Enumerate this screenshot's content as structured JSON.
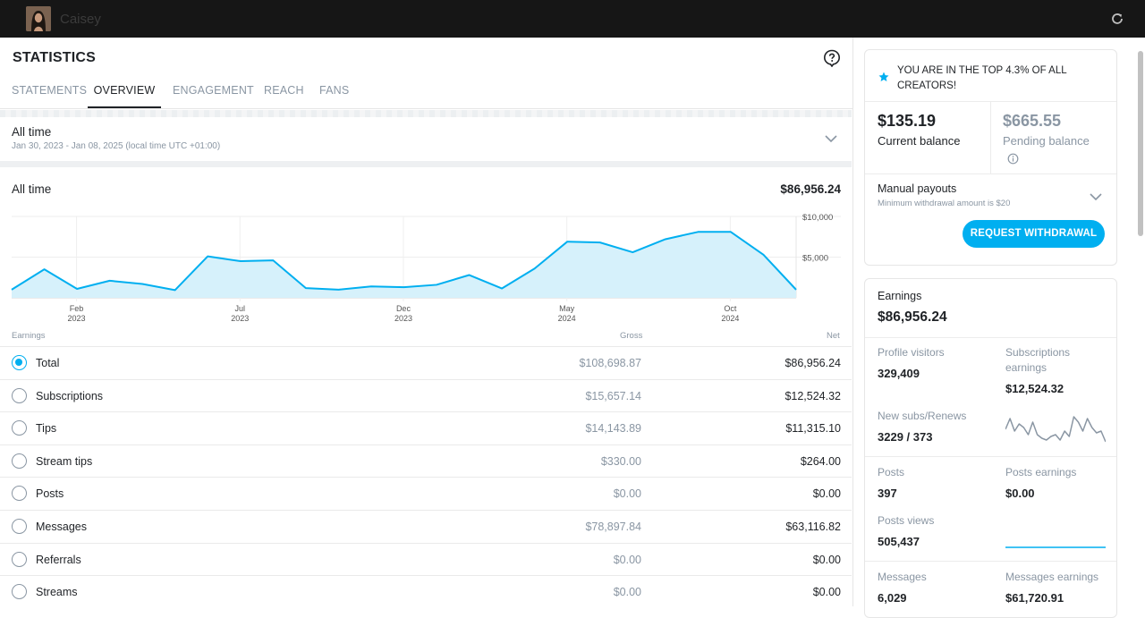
{
  "topbar": {
    "username": "Caisey"
  },
  "page": {
    "title": "STATISTICS",
    "tabs": [
      "STATEMENTS",
      "OVERVIEW",
      "ENGAGEMENT",
      "REACH",
      "FANS"
    ],
    "active_tab": "OVERVIEW"
  },
  "range": {
    "title": "All time",
    "subtitle": "Jan 30, 2023 - Jan 08, 2025 (local time UTC +01:00)"
  },
  "summary": {
    "label": "All time",
    "total": "$86,956.24"
  },
  "chart_data": {
    "type": "area",
    "x_ticks": [
      {
        "month": "Feb",
        "year": "2023"
      },
      {
        "month": "Jul",
        "year": "2023"
      },
      {
        "month": "Dec",
        "year": "2023"
      },
      {
        "month": "May",
        "year": "2024"
      },
      {
        "month": "Oct",
        "year": "2024"
      }
    ],
    "y_ticks": [
      "$10,000",
      "$5,000"
    ],
    "ylim": [
      0,
      10000
    ],
    "values": [
      1000,
      3500,
      1100,
      2100,
      1700,
      950,
      5100,
      4500,
      4600,
      1200,
      1000,
      1400,
      1300,
      1600,
      2800,
      1150,
      3600,
      6900,
      6800,
      5600,
      7200,
      8100,
      8100,
      5300,
      1000
    ],
    "color": "#00aff0",
    "fill": "#d6f1fb"
  },
  "table": {
    "headers": {
      "earnings": "Earnings",
      "gross": "Gross",
      "net": "Net"
    },
    "rows": [
      {
        "label": "Total",
        "gross": "$108,698.87",
        "net": "$86,956.24",
        "selected": true
      },
      {
        "label": "Subscriptions",
        "gross": "$15,657.14",
        "net": "$12,524.32",
        "selected": false
      },
      {
        "label": "Tips",
        "gross": "$14,143.89",
        "net": "$11,315.10",
        "selected": false
      },
      {
        "label": "Stream tips",
        "gross": "$330.00",
        "net": "$264.00",
        "selected": false
      },
      {
        "label": "Posts",
        "gross": "$0.00",
        "net": "$0.00",
        "selected": false
      },
      {
        "label": "Messages",
        "gross": "$78,897.84",
        "net": "$63,116.82",
        "selected": false
      },
      {
        "label": "Referrals",
        "gross": "$0.00",
        "net": "$0.00",
        "selected": false
      },
      {
        "label": "Streams",
        "gross": "$0.00",
        "net": "$0.00",
        "selected": false
      }
    ]
  },
  "balance": {
    "top_text": "YOU ARE IN THE TOP 4.3% OF ALL CREATORS!",
    "current_amount": "$135.19",
    "current_label": "Current balance",
    "pending_amount": "$665.55",
    "pending_label": "Pending balance",
    "payout_title": "Manual payouts",
    "payout_sub": "Minimum withdrawal amount is $20",
    "withdraw_button": "REQUEST WITHDRAWAL"
  },
  "earnings_card": {
    "title": "Earnings",
    "total": "$86,956.24",
    "profile_visitors_label": "Profile visitors",
    "profile_visitors": "329,409",
    "subs_earnings_label": "Subscriptions earnings",
    "subs_earnings": "$12,524.32",
    "new_subs_label": "New subs/Renews",
    "new_subs": "3229 / 373",
    "posts_label": "Posts",
    "posts": "397",
    "posts_earnings_label": "Posts earnings",
    "posts_earnings": "$0.00",
    "posts_views_label": "Posts views",
    "posts_views": "505,437",
    "messages_label": "Messages",
    "messages": "6,029",
    "messages_earnings_label": "Messages earnings",
    "messages_earnings": "$61,720.91"
  },
  "sparkline_subs": [
    22,
    10,
    24,
    16,
    20,
    28,
    14,
    28,
    32,
    34,
    30,
    28,
    34,
    24,
    30,
    8,
    14,
    24,
    10,
    20,
    26,
    24,
    36
  ],
  "icons": {
    "refresh": "refresh-icon",
    "help": "help-icon",
    "star": "star-icon",
    "info": "info-icon",
    "chevron": "chevron-down-icon"
  }
}
